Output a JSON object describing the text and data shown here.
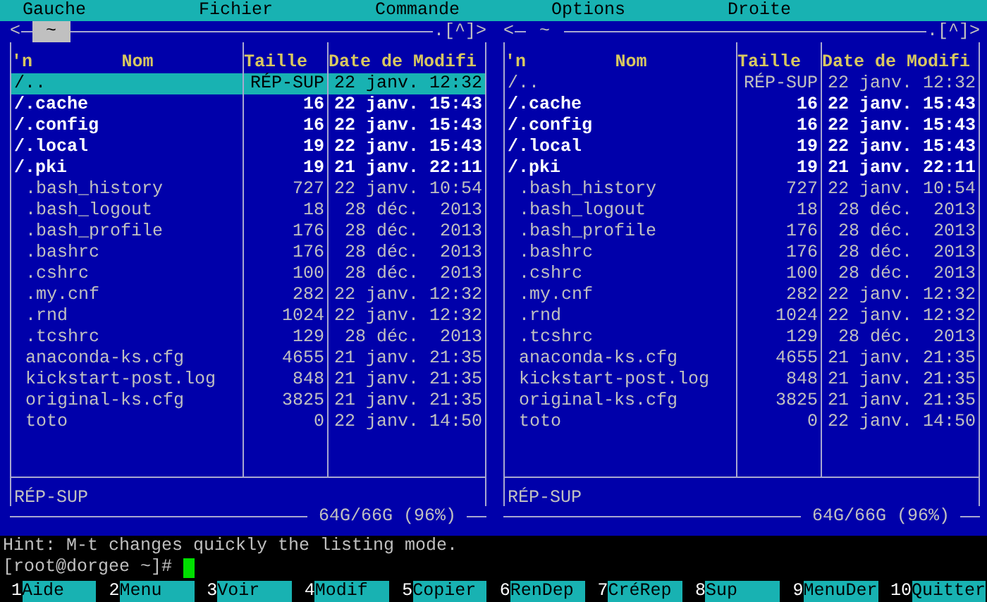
{
  "menu": [
    "Gauche",
    "Fichier",
    "Commande",
    "Options",
    "Droite"
  ],
  "panels": [
    {
      "active": true,
      "nav_left": "<",
      "path": "~",
      "nav_right": ".[^]>",
      "sort_mark": "'n",
      "columns": [
        "Nom",
        "Taille",
        "Date de Modifi"
      ],
      "rows": [
        {
          "kind": "updir",
          "name": "/..",
          "size": "RÉP-SUP",
          "date": "22 janv. 12:32",
          "selected": true
        },
        {
          "kind": "dir",
          "name": "/.cache",
          "size": "16",
          "date": "22 janv. 15:43",
          "selected": false
        },
        {
          "kind": "dir",
          "name": "/.config",
          "size": "16",
          "date": "22 janv. 15:43",
          "selected": false
        },
        {
          "kind": "dir",
          "name": "/.local",
          "size": "19",
          "date": "22 janv. 15:43",
          "selected": false
        },
        {
          "kind": "dir",
          "name": "/.pki",
          "size": "19",
          "date": "21 janv. 22:11",
          "selected": false
        },
        {
          "kind": "file",
          "name": ".bash_history",
          "size": "727",
          "date": "22 janv. 10:54",
          "selected": false
        },
        {
          "kind": "file",
          "name": ".bash_logout",
          "size": "18",
          "date": "28 déc.  2013",
          "selected": false
        },
        {
          "kind": "file",
          "name": ".bash_profile",
          "size": "176",
          "date": "28 déc.  2013",
          "selected": false
        },
        {
          "kind": "file",
          "name": ".bashrc",
          "size": "176",
          "date": "28 déc.  2013",
          "selected": false
        },
        {
          "kind": "file",
          "name": ".cshrc",
          "size": "100",
          "date": "28 déc.  2013",
          "selected": false
        },
        {
          "kind": "file",
          "name": ".my.cnf",
          "size": "282",
          "date": "22 janv. 12:32",
          "selected": false
        },
        {
          "kind": "file",
          "name": ".rnd",
          "size": "1024",
          "date": "22 janv. 12:32",
          "selected": false
        },
        {
          "kind": "file",
          "name": ".tcshrc",
          "size": "129",
          "date": "28 déc.  2013",
          "selected": false
        },
        {
          "kind": "file",
          "name": "anaconda-ks.cfg",
          "size": "4655",
          "date": "21 janv. 21:35",
          "selected": false
        },
        {
          "kind": "file",
          "name": "kickstart-post.log",
          "size": "848",
          "date": "21 janv. 21:35",
          "selected": false
        },
        {
          "kind": "file",
          "name": "original-ks.cfg",
          "size": "3825",
          "date": "21 janv. 21:35",
          "selected": false
        },
        {
          "kind": "file",
          "name": "toto",
          "size": "0",
          "date": "22 janv. 14:50",
          "selected": false
        }
      ],
      "status": "RÉP-SUP",
      "disk": "64G/66G (96%)"
    },
    {
      "active": false,
      "nav_left": "<",
      "path": "~",
      "nav_right": ".[^]>",
      "sort_mark": "'n",
      "columns": [
        "Nom",
        "Taille",
        "Date de Modifi"
      ],
      "rows": [
        {
          "kind": "updir",
          "name": "/..",
          "size": "RÉP-SUP",
          "date": "22 janv. 12:32",
          "selected": false
        },
        {
          "kind": "dir",
          "name": "/.cache",
          "size": "16",
          "date": "22 janv. 15:43",
          "selected": false
        },
        {
          "kind": "dir",
          "name": "/.config",
          "size": "16",
          "date": "22 janv. 15:43",
          "selected": false
        },
        {
          "kind": "dir",
          "name": "/.local",
          "size": "19",
          "date": "22 janv. 15:43",
          "selected": false
        },
        {
          "kind": "dir",
          "name": "/.pki",
          "size": "19",
          "date": "21 janv. 22:11",
          "selected": false
        },
        {
          "kind": "file",
          "name": ".bash_history",
          "size": "727",
          "date": "22 janv. 10:54",
          "selected": false
        },
        {
          "kind": "file",
          "name": ".bash_logout",
          "size": "18",
          "date": "28 déc.  2013",
          "selected": false
        },
        {
          "kind": "file",
          "name": ".bash_profile",
          "size": "176",
          "date": "28 déc.  2013",
          "selected": false
        },
        {
          "kind": "file",
          "name": ".bashrc",
          "size": "176",
          "date": "28 déc.  2013",
          "selected": false
        },
        {
          "kind": "file",
          "name": ".cshrc",
          "size": "100",
          "date": "28 déc.  2013",
          "selected": false
        },
        {
          "kind": "file",
          "name": ".my.cnf",
          "size": "282",
          "date": "22 janv. 12:32",
          "selected": false
        },
        {
          "kind": "file",
          "name": ".rnd",
          "size": "1024",
          "date": "22 janv. 12:32",
          "selected": false
        },
        {
          "kind": "file",
          "name": ".tcshrc",
          "size": "129",
          "date": "28 déc.  2013",
          "selected": false
        },
        {
          "kind": "file",
          "name": "anaconda-ks.cfg",
          "size": "4655",
          "date": "21 janv. 21:35",
          "selected": false
        },
        {
          "kind": "file",
          "name": "kickstart-post.log",
          "size": "848",
          "date": "21 janv. 21:35",
          "selected": false
        },
        {
          "kind": "file",
          "name": "original-ks.cfg",
          "size": "3825",
          "date": "21 janv. 21:35",
          "selected": false
        },
        {
          "kind": "file",
          "name": "toto",
          "size": "0",
          "date": "22 janv. 14:50",
          "selected": false
        }
      ],
      "status": "RÉP-SUP",
      "disk": "64G/66G (96%)"
    }
  ],
  "hint": "Hint: M-t changes quickly the listing mode.",
  "prompt": "[root@dorgee ~]#",
  "fkeys": [
    {
      "number": "1",
      "label": "Aide"
    },
    {
      "number": "2",
      "label": "Menu"
    },
    {
      "number": "3",
      "label": "Voir"
    },
    {
      "number": "4",
      "label": "Modif"
    },
    {
      "number": "5",
      "label": "Copier"
    },
    {
      "number": "6",
      "label": "RenDep"
    },
    {
      "number": "7",
      "label": "CréRep"
    },
    {
      "number": "8",
      "label": "Sup"
    },
    {
      "number": "9",
      "label": "MenuDer"
    },
    {
      "number": "10",
      "label": "Quitter"
    }
  ]
}
